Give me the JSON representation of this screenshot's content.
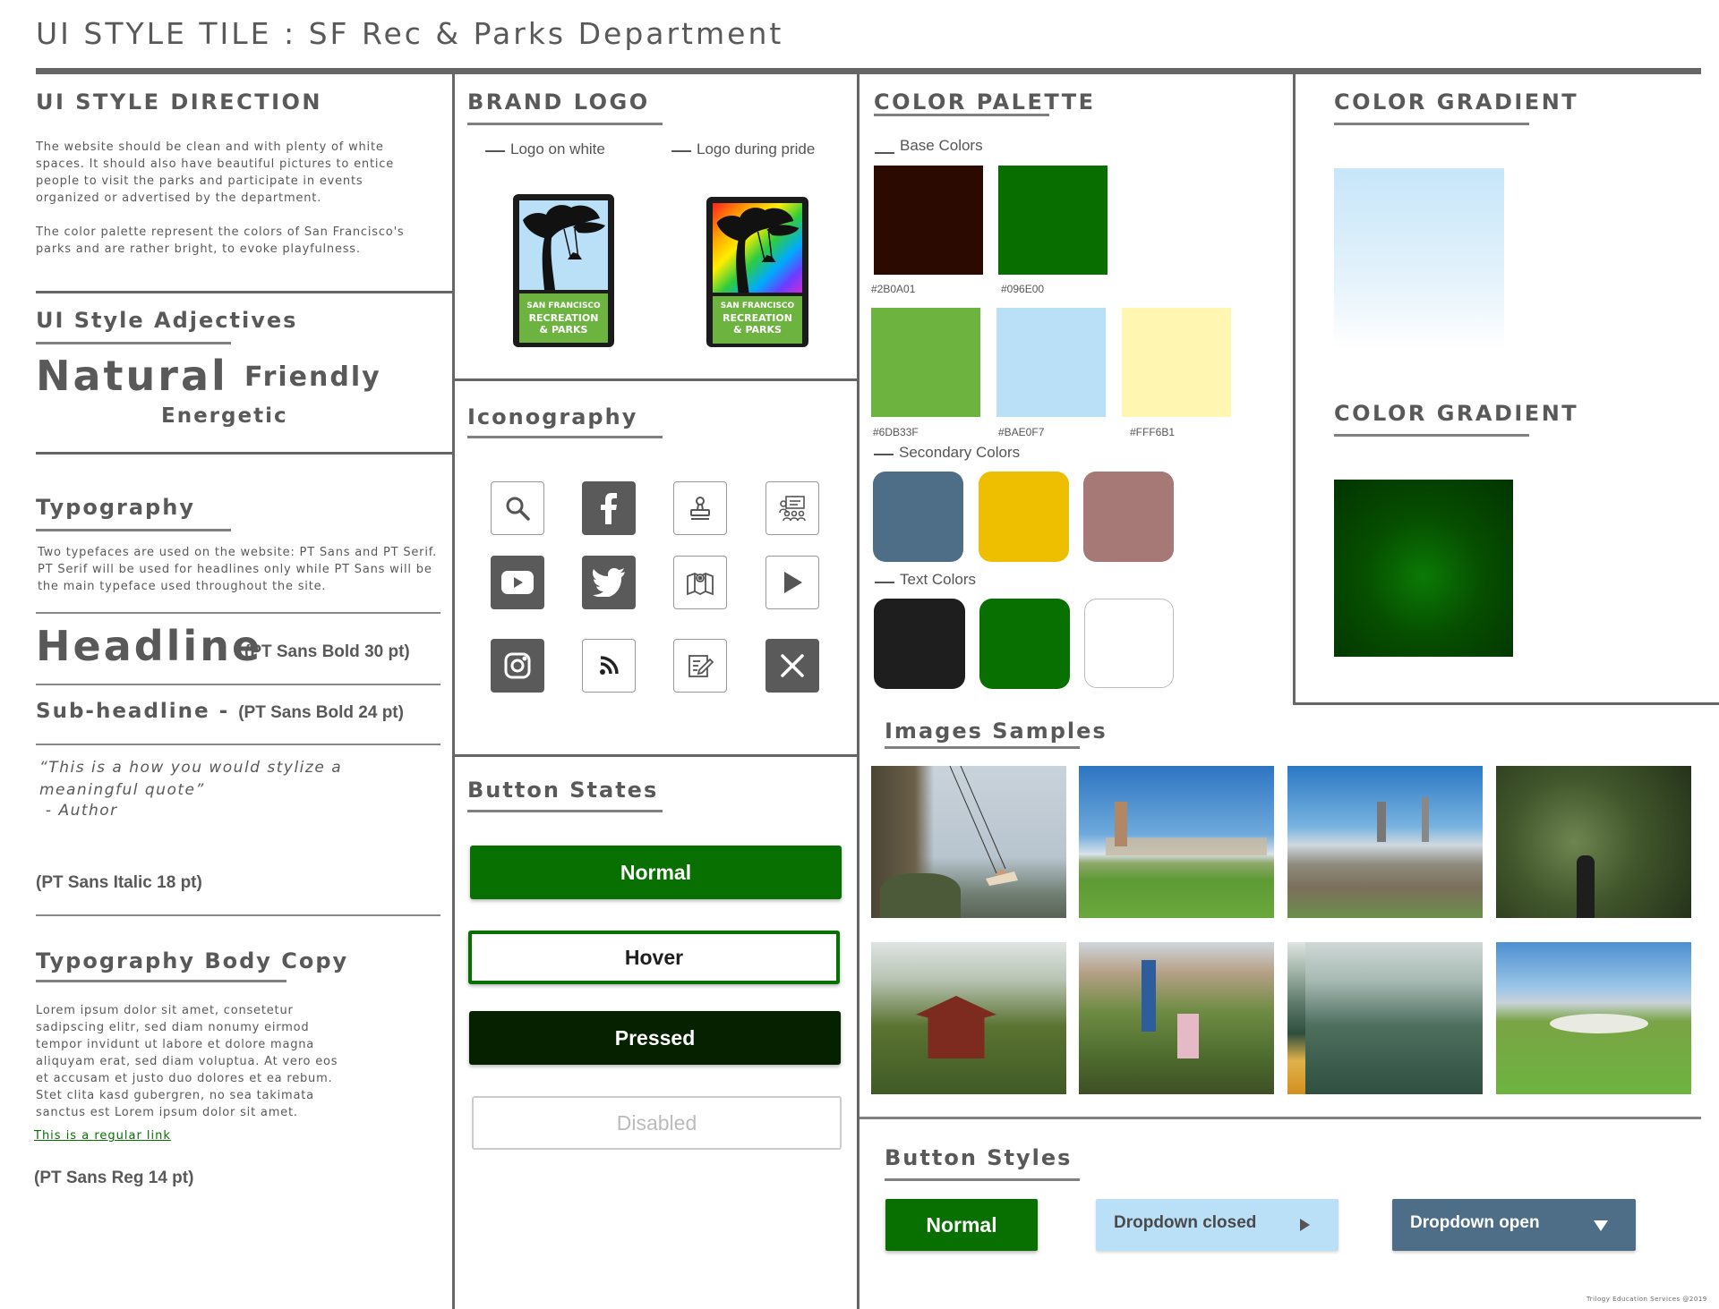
{
  "title": "UI STYLE TILE : SF Rec & Parks Department",
  "direction": {
    "title": "UI STYLE DIRECTION",
    "para1": "The website should be clean and with plenty of white spaces. It should also have beautiful pictures to entice people to visit the parks and participate in events organized or advertised by the department.",
    "para2": "The color palette represent the colors of San Francisco's parks and are rather bright, to evoke playfulness."
  },
  "adjectives": {
    "title": "UI Style Adjectives",
    "words": [
      "Natural",
      "Friendly",
      "Energetic"
    ]
  },
  "typography": {
    "title": "Typography",
    "description": "Two typefaces are used on the website: PT Sans and PT Serif. PT Serif will be used for headlines only while PT Sans will be the main typeface used throughout the site.",
    "headline": "Headline",
    "headline_note": "(PT Sans Bold 30 pt)",
    "subheadline": "Sub-headline - ",
    "subheadline_note": "(PT Sans Bold 24 pt)",
    "quote": "“This is a how you would stylize a meaningful quote”",
    "quote_author": " - Author",
    "quote_note": "(PT Sans Italic 18 pt)"
  },
  "body_copy": {
    "title": "Typography Body Copy",
    "text": "Lorem ipsum dolor sit amet, consetetur sadipscing elitr, sed diam nonumy eirmod tempor invidunt ut labore et dolore magna aliquyam erat, sed diam voluptua. At vero eos et accusam et justo duo dolores et ea rebum. Stet clita kasd gubergren, no sea takimata sanctus est Lorem ipsum dolor sit amet.",
    "link": "This is a regular link",
    "note": "(PT Sans Reg 14 pt)"
  },
  "brand_logo": {
    "title": "BRAND LOGO",
    "label_white": "Logo on white",
    "label_pride": "Logo during pride",
    "logo_lines": [
      "SAN FRANCISCO",
      "RECREATION",
      "& PARKS"
    ]
  },
  "iconography": {
    "title": "Iconography",
    "icons": [
      "search-icon",
      "facebook-icon",
      "stamp-icon",
      "meeting-icon",
      "youtube-icon",
      "twitter-icon",
      "map-icon",
      "play-icon",
      "instagram-icon",
      "rss-icon",
      "edit-icon",
      "close-icon"
    ]
  },
  "button_states": {
    "title": "Button States",
    "normal": "Normal",
    "hover": "Hover",
    "pressed": "Pressed",
    "disabled": "Disabled"
  },
  "palette": {
    "title": "COLOR PALETTE",
    "base_label": "Base Colors",
    "base": [
      {
        "hex": "#2B0A01",
        "label": "#2B0A01"
      },
      {
        "hex": "#096E00",
        "label": "#096E00"
      },
      {
        "hex": "#6DB33F",
        "label": "#6DB33F"
      },
      {
        "hex": "#BAE0F7",
        "label": "#BAE0F7"
      },
      {
        "hex": "#FFF6B1",
        "label": "#FFF6B1"
      }
    ],
    "secondary_label": "Secondary Colors",
    "secondary": [
      "#4E6E87",
      "#EEBF00",
      "#A67976"
    ],
    "text_label": "Text Colors",
    "text": [
      "#1E1E1E",
      "#087000",
      "#FFFFFF"
    ]
  },
  "gradient": {
    "title1": "COLOR GRADIENT",
    "title2": "COLOR GRADIENT"
  },
  "images": {
    "title": "Images Samples"
  },
  "button_styles": {
    "title": "Button Styles",
    "normal": "Normal",
    "dropdown_closed": "Dropdown closed",
    "dropdown_open": "Dropdown open"
  },
  "footer": "Trilogy Education Services @2019"
}
